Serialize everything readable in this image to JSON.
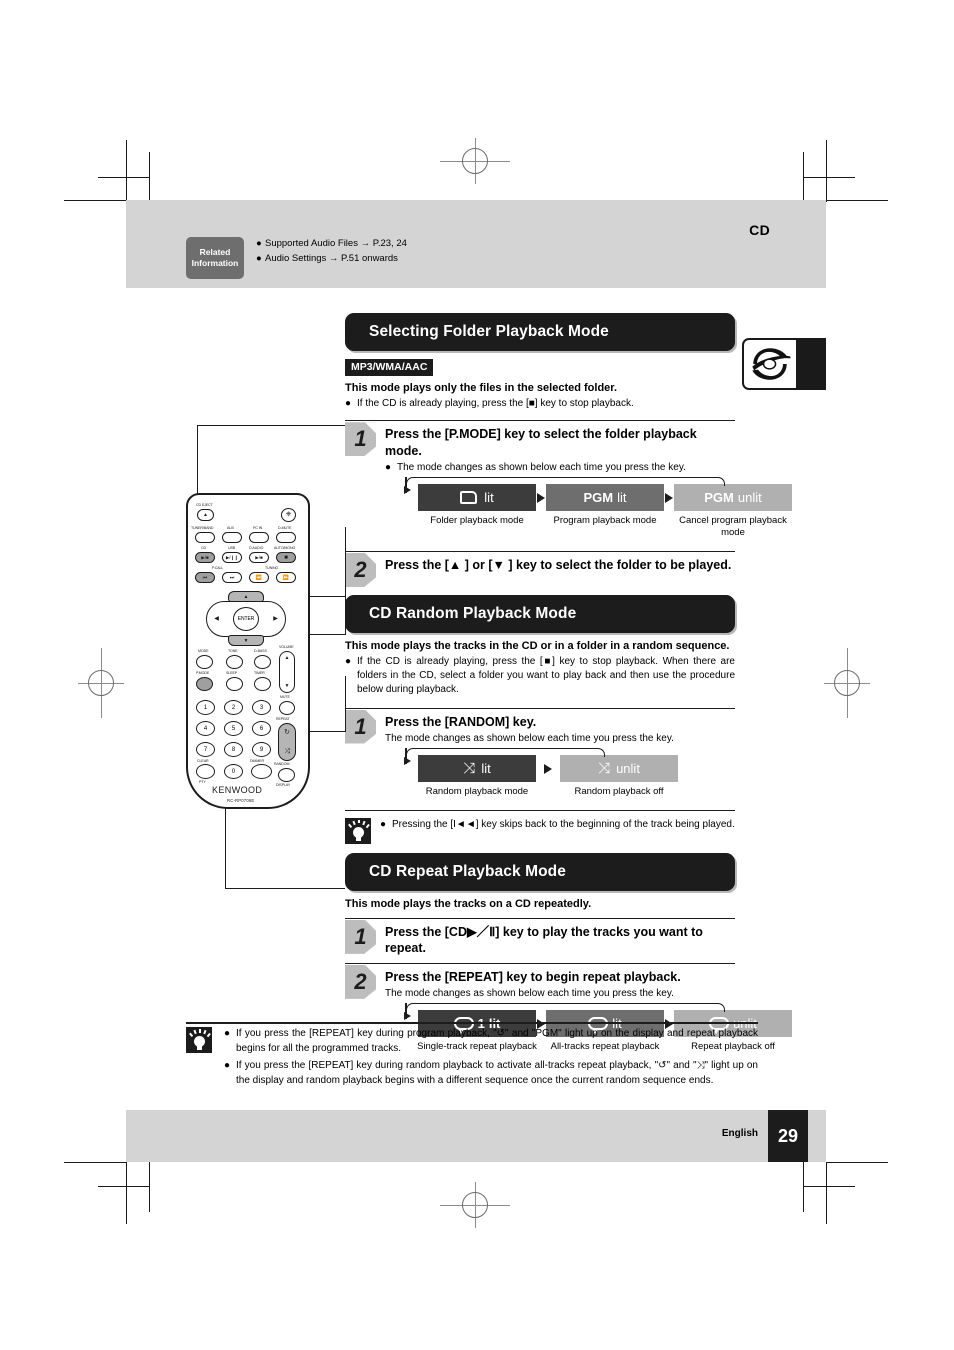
{
  "header": {
    "cd_label": "CD",
    "related_box_line1": "Related",
    "related_box_line2": "Information",
    "related_items": [
      "Supported Audio Files → P.23, 24",
      "Audio Settings → P.51 onwards"
    ]
  },
  "footer": {
    "language": "English",
    "page": "29"
  },
  "sections": [
    {
      "title": "Selecting Folder Playback Mode",
      "tag": "MP3/WMA/AAC",
      "lead": "This mode plays only the files in the selected folder.",
      "bullets": [
        "If the CD is already playing, press the [■] key to stop playback."
      ],
      "steps": [
        {
          "num": "1",
          "title": "Press the [P.MODE] key to select the folder playback mode.",
          "sub": "The mode changes as shown below each time you press the key.",
          "sub_bulleted": true,
          "flow": {
            "chips": [
              {
                "icon": "folder-icon",
                "bold_text": "",
                "label": "lit",
                "label_bold": false,
                "shade": "dark",
                "caption": "Folder playback mode"
              },
              {
                "icon": "none",
                "bold_text": "PGM",
                "label": "lit",
                "label_bold": false,
                "shade": "mid",
                "caption": "Program playback mode"
              },
              {
                "icon": "none",
                "bold_text": "PGM",
                "label": "unlit",
                "label_bold": false,
                "shade": "light",
                "caption": "Cancel program playback mode"
              }
            ]
          }
        },
        {
          "num": "2",
          "title": "Press the [▲ ] or [▼ ] key to select the folder to be played.",
          "sub": "",
          "sub_bulleted": false,
          "flow": null
        }
      ]
    },
    {
      "title": "CD Random Playback Mode",
      "tag": "",
      "lead": "This mode plays the tracks in the CD or in a folder in a random sequence.",
      "bullets": [
        "If the CD is already playing, press the [■] key to stop playback. When there are folders in the CD, select a folder you want to play back and then use the procedure below during playback."
      ],
      "steps": [
        {
          "num": "1",
          "title": "Press the [RANDOM] key.",
          "sub": "The mode changes as shown below each time you press the key.",
          "sub_bulleted": false,
          "flow": {
            "chips": [
              {
                "icon": "shuffle-icon",
                "bold_text": "",
                "label": "lit",
                "label_bold": false,
                "shade": "dark",
                "caption": "Random playback mode"
              },
              {
                "icon": "shuffle-icon",
                "bold_text": "",
                "label": "unlit",
                "label_bold": false,
                "shade": "light",
                "caption": "Random playback off"
              }
            ]
          }
        }
      ],
      "hint": [
        "Pressing the [I◄◄] key skips back to the beginning of the track being played."
      ]
    },
    {
      "title": "CD Repeat Playback Mode",
      "tag": "",
      "lead": "This mode plays the tracks on a CD repeatedly.",
      "bullets": [],
      "steps": [
        {
          "num": "1",
          "title": "Press the [CD▶／Ⅱ] key to play the tracks you want to repeat.",
          "sub": "",
          "sub_bulleted": false,
          "flow": null
        },
        {
          "num": "2",
          "title": "Press the [REPEAT] key to begin repeat playback.",
          "sub": "The mode changes as shown below each time you press the key.",
          "sub_bulleted": false,
          "flow": {
            "chips": [
              {
                "icon": "repeat-icon",
                "bold_text": "1",
                "label": "lit",
                "label_bold": true,
                "shade": "dark",
                "caption": "Single-track repeat playback"
              },
              {
                "icon": "repeat-icon",
                "bold_text": "",
                "label": "lit",
                "label_bold": false,
                "shade": "mid",
                "caption": "All-tracks repeat playback"
              },
              {
                "icon": "repeat-icon",
                "bold_text": "",
                "label": "unlit",
                "label_bold": false,
                "shade": "light",
                "caption": "Repeat playback off"
              }
            ]
          }
        }
      ]
    }
  ],
  "bottom_note": [
    "If you press the [REPEAT] key during program playback, \"↺\" and \"PGM\" light up on the display and repeat playback begins for all the programmed tracks.",
    "If you press the [REPEAT] key during random playback to activate all-tracks repeat playback, \"↺\" and \"⤨\" light up on the display and random playback begins with a different sequence once the current random sequence ends."
  ],
  "remote": {
    "brand": "KENWOOD",
    "model": "RC-RP0706E",
    "labels": {
      "cd_eject": "CD EJECT",
      "tuner_band": "TUNER/BAND",
      "aux": "AUX",
      "pc_in": "PC IN",
      "d_mute": "D-MUTE",
      "cd": "CD",
      "usb": "USB",
      "d_audio": "D.AUDIO",
      "auto_mono": "AUTO/MONO",
      "p_call": "P.CALL",
      "tuning": "TUNING",
      "enter": "ENTER",
      "mode": "MODE",
      "tone": "TONE",
      "d_bass": "D-BASS",
      "p_mode": "P.MODE",
      "sleep": "SLEEP",
      "timer": "TIMER",
      "volume": "VOLUME",
      "mute": "MUTE",
      "repeat": "REPEAT",
      "random": "RANDOM",
      "clear": "CLEAR",
      "dimmer": "DIMMER",
      "pty": "PTY",
      "display": "DISPLAY"
    },
    "keypad": [
      "1",
      "2",
      "3",
      "4",
      "5",
      "6",
      "7",
      "8",
      "9",
      "0"
    ]
  }
}
